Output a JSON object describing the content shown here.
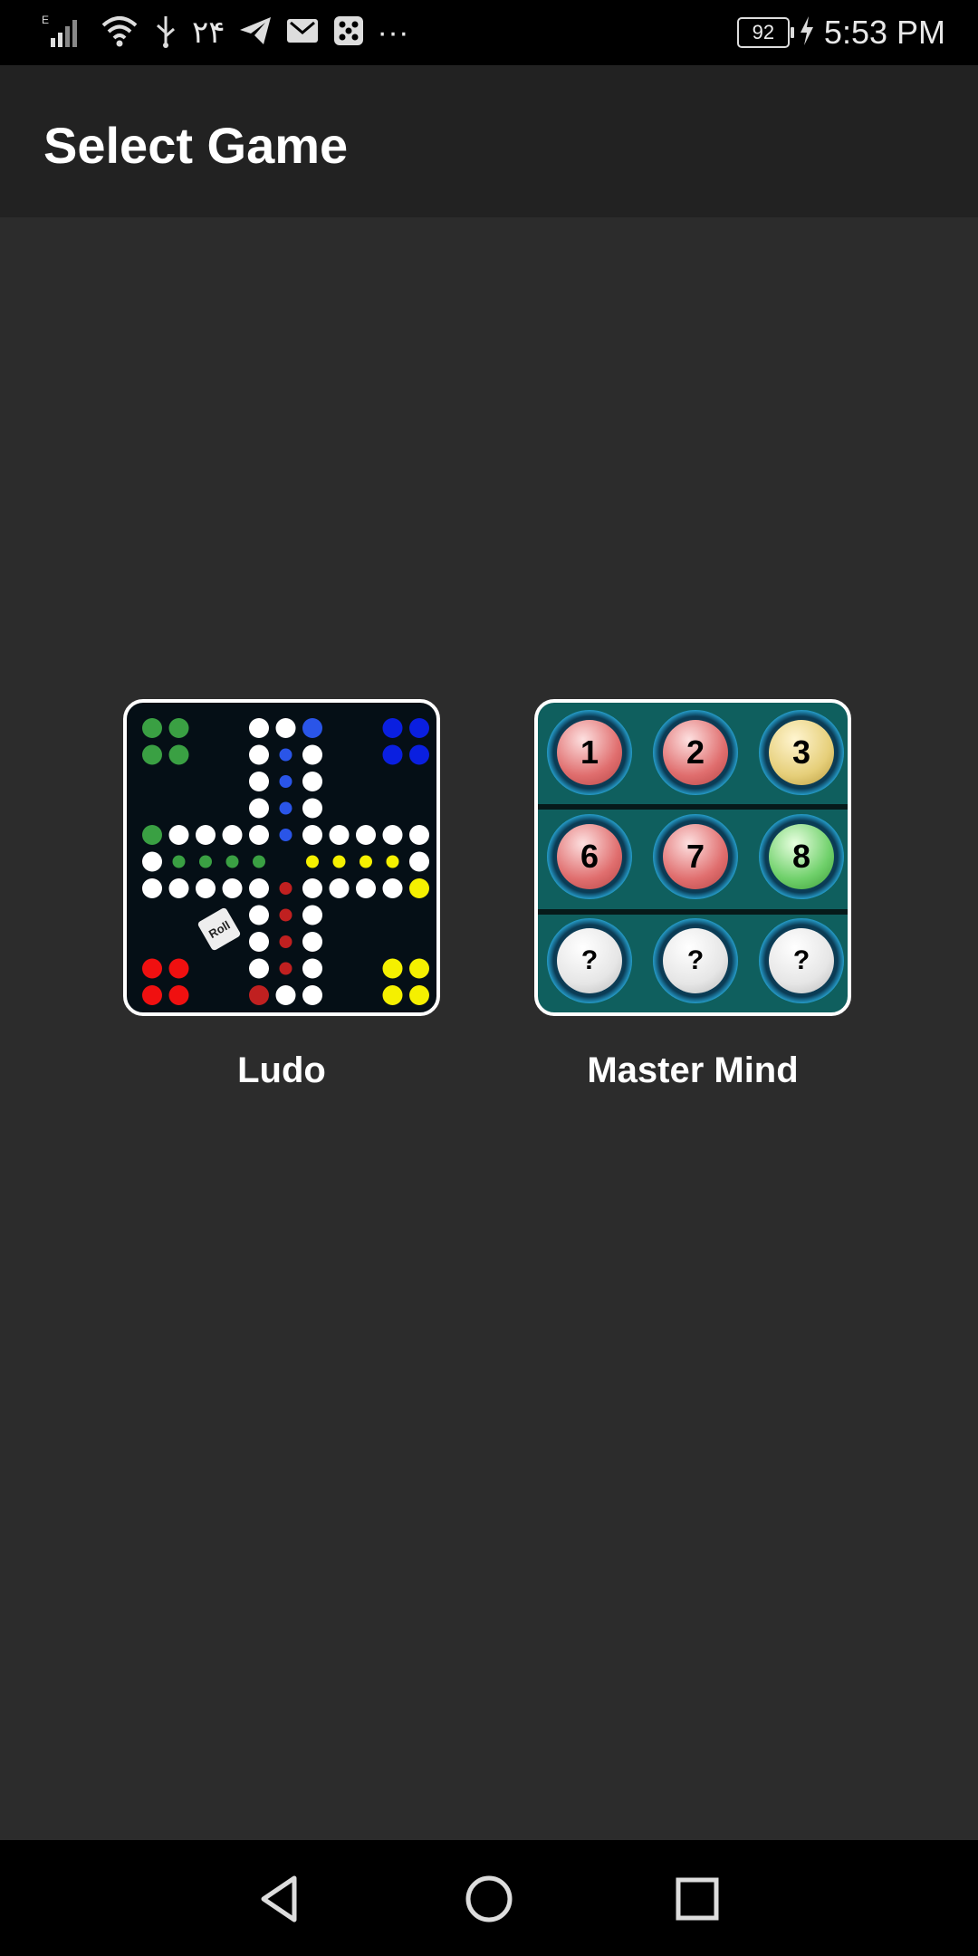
{
  "status_bar": {
    "left_text": "۲۴",
    "ellipsis": "···",
    "battery": "92",
    "time": "5:53 PM",
    "icons": [
      "signal-icon",
      "wifi-icon",
      "usb-icon",
      "telegram-icon",
      "gmail-icon",
      "dice-icon",
      "more-icon",
      "battery-icon",
      "charging-icon"
    ]
  },
  "app_bar": {
    "title": "Select Game"
  },
  "games": [
    {
      "label": "Ludo",
      "die_text": "Roll"
    },
    {
      "label": "Master Mind",
      "balls": [
        "1",
        "2",
        "3",
        "6",
        "7",
        "8",
        "?",
        "?",
        "?"
      ]
    }
  ],
  "nav_bar": {
    "icons": [
      "back-icon",
      "home-icon",
      "recents-icon"
    ]
  },
  "colors": {
    "background": "#2c2c2c",
    "app_bar": "#222222",
    "ludo_board": "#050f16",
    "mastermind_board": "#0f5f5e"
  }
}
